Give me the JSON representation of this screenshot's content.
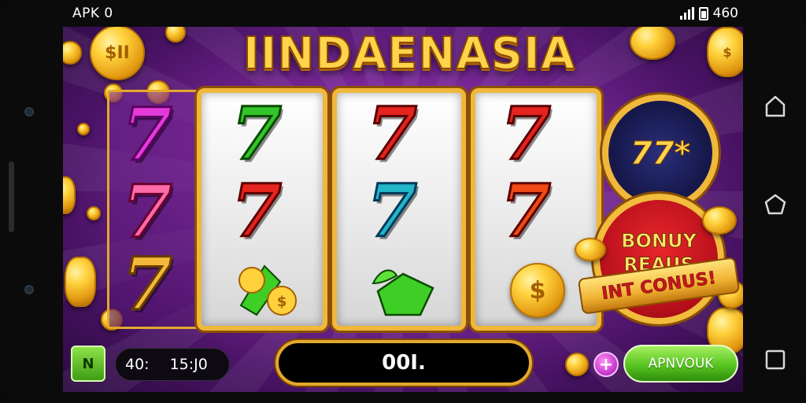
{
  "status_bar": {
    "left_text": "APK 0",
    "right_text": "460",
    "icons": [
      "signal-icon",
      "battery-icon"
    ]
  },
  "game": {
    "title": "IINDAENASIA",
    "colors": {
      "title_gold": "#ffd34a",
      "purple_bg": "#7d2a9c",
      "reel_frame": "#f0b83a",
      "spin_green": "#57c421"
    },
    "reels": {
      "left_column": [
        {
          "glyph": "7",
          "color": "#e23ad8"
        },
        {
          "glyph": "7",
          "color": "#ff6aa8"
        },
        {
          "glyph": "7",
          "color": "#f4b93a"
        }
      ],
      "reel_1": [
        {
          "glyph": "7",
          "color": "#34c42b"
        },
        {
          "glyph": "7",
          "color": "#e5231f"
        },
        {
          "glyph": "coin-stack-icon",
          "color": "#ffd23d"
        }
      ],
      "reel_2": [
        {
          "glyph": "7",
          "color": "#e5231f"
        },
        {
          "glyph": "7",
          "color": "#22b6c9"
        },
        {
          "glyph": "green-gem-icon",
          "color": "#3fce25"
        }
      ],
      "reel_3": [
        {
          "glyph": "7",
          "color": "#e5231f"
        },
        {
          "glyph": "7",
          "color": "#f04a15"
        },
        {
          "glyph": "dollar-coin-icon",
          "color": "#ffd23d"
        }
      ]
    },
    "coin_labels": {
      "top_left": "$II",
      "dollar": "$"
    },
    "bonus": {
      "wheel_text": "77*",
      "line1": "BONUY",
      "line2": "REAUS",
      "ribbon": "INT CONUS!"
    },
    "bottom_bar": {
      "green_button_label": "N",
      "time_left": "40:",
      "time_right": "15:J0",
      "spin_value": "00I.",
      "plus_label": "+",
      "approve_label": "APNVOUK"
    }
  },
  "nav": {
    "home_icon": "home-outline-icon",
    "home_alt_icon": "home-icon",
    "recents_icon": "square-icon"
  }
}
